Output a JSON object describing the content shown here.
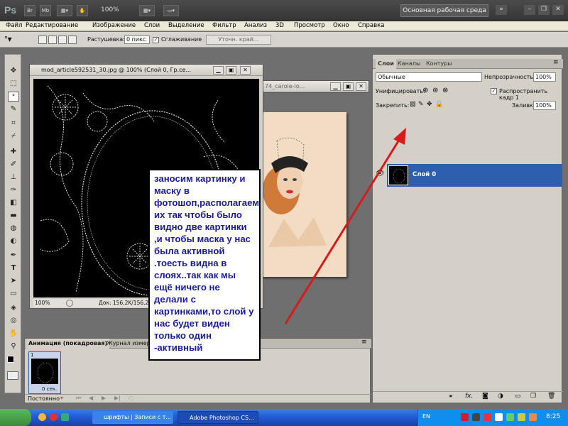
{
  "appbar": {
    "logo": "Ps",
    "buttons": [
      "Br",
      "Mb"
    ],
    "zoom": "100%",
    "workspace": "Основная рабочая среда"
  },
  "menu": [
    "Файл",
    "Редактирование",
    "Изображение",
    "Слои",
    "Выделение",
    "Фильтр",
    "Анализ",
    "3D",
    "Просмотр",
    "Окно",
    "Справка"
  ],
  "options": {
    "feather_label": "Растушевка:",
    "feather_value": "0 пикс",
    "antialias_label": "Сглаживание",
    "refine_edge": "Уточн. край..."
  },
  "doc1": {
    "title": "mod_article592531_30.jpg @ 100% (Слой 0, Гр.се...",
    "zoom": "100%",
    "status": "Док: 156,2K/156,2K"
  },
  "doc2": {
    "title": "74_carole-lo..."
  },
  "callout": "заносим картинку и маску в фотошоп,располагаем их так чтобы было видно две картинки ,и чтобы маска у нас была активной .тоесть видна в слоях..так как мы ещё ничего не делали с картинками,то слой у нас будет виден только один -активный",
  "layers": {
    "tabs": [
      "Слои",
      "Каналы",
      "Контуры"
    ],
    "blend_mode": "Обычные",
    "opacity_label": "Непрозрачность:",
    "opacity_value": "100%",
    "unify_label": "Унифицировать:",
    "propagate_label": "Распространить кадр 1",
    "lock_label": "Закрепить:",
    "fill_label": "Заливка:",
    "fill_value": "100%",
    "layer_name": "Слой 0"
  },
  "animation": {
    "tabs": [
      "Анимация (покадровая)",
      "Журнал измере"
    ],
    "frame_number": "1",
    "frame_delay": "0 сек.",
    "loop": "Постоянно"
  },
  "taskbar": {
    "tasks": [
      "шрифты | Записи с т...",
      "Adobe Photoshop CS..."
    ],
    "lang": "EN",
    "clock": "8:25"
  }
}
